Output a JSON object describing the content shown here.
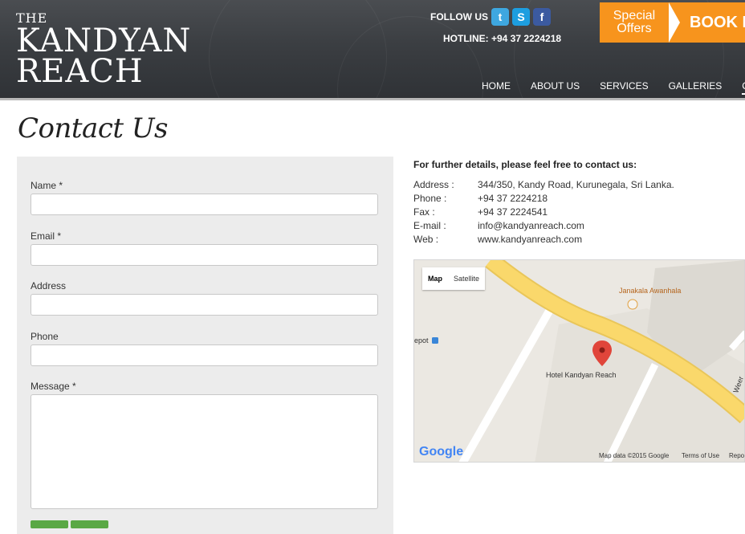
{
  "header": {
    "logo": {
      "the": "THE",
      "line1": "KANDYAN",
      "line2": "REACH"
    },
    "follow_label": "FOLLOW US",
    "social": [
      {
        "name": "twitter",
        "glyph": "t"
      },
      {
        "name": "skype",
        "glyph": "S"
      },
      {
        "name": "facebook",
        "glyph": "f"
      }
    ],
    "hotline": "HOTLINE: +94 37 2224218",
    "special_offers": {
      "line1": "Special",
      "line2": "Offers"
    },
    "book_label": "BOOK N",
    "nav": [
      {
        "label": "HOME"
      },
      {
        "label": "ABOUT US"
      },
      {
        "label": "SERVICES"
      },
      {
        "label": "GALLERIES"
      },
      {
        "label": "CO"
      }
    ]
  },
  "page_title": "Contact Us",
  "form": {
    "name_label": "Name *",
    "email_label": "Email *",
    "address_label": "Address",
    "phone_label": "Phone",
    "message_label": "Message *"
  },
  "details": {
    "intro": "For further details, please feel free to contact us:",
    "rows": [
      {
        "k": "Address :",
        "v": "344/350, Kandy Road, Kurunegala, Sri Lanka."
      },
      {
        "k": "Phone :",
        "v": "+94 37 2224218"
      },
      {
        "k": "Fax :",
        "v": "+94 37 2224541"
      },
      {
        "k": "E-mail :",
        "v": "info@kandyanreach.com"
      },
      {
        "k": "Web :",
        "v": "www.kandyanreach.com"
      }
    ]
  },
  "map": {
    "type_map": "Map",
    "type_satellite": "Satellite",
    "label_hotel": "Hotel Kandyan Reach",
    "label_restaurant": "Janakala Awanhala",
    "label_depot": "epot",
    "google": "Google",
    "footer_data": "Map data ©2015 Google",
    "footer_terms": "Terms of Use",
    "footer_report": "Repo",
    "road_label": "Weer"
  },
  "colors": {
    "accent": "#f7941d",
    "header_bg": "#3b3e42",
    "road": "#fad86b",
    "pin": "#e0453a"
  }
}
